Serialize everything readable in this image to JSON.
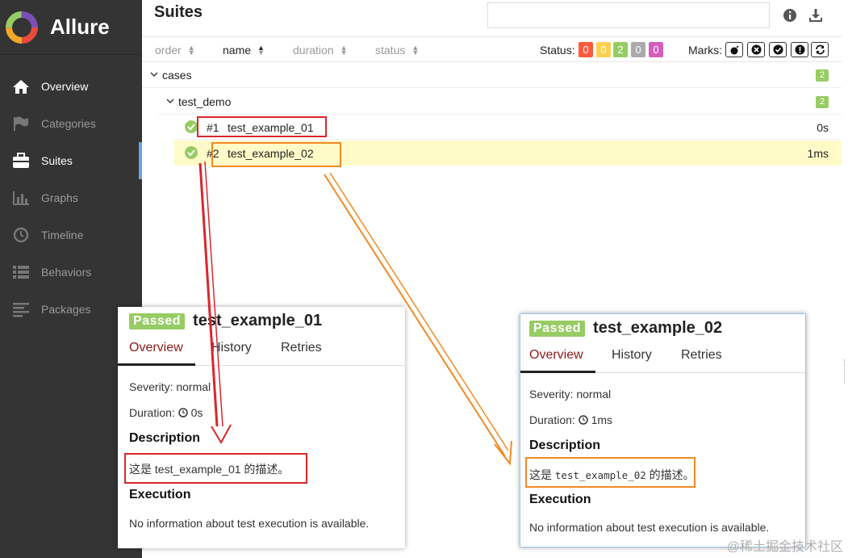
{
  "brand": {
    "name": "Allure"
  },
  "sidebar": {
    "items": [
      {
        "label": "Overview",
        "icon": "home-icon",
        "state": "highlight"
      },
      {
        "label": "Categories",
        "icon": "flag-icon",
        "state": "dim"
      },
      {
        "label": "Suites",
        "icon": "briefcase-icon",
        "state": "active"
      },
      {
        "label": "Graphs",
        "icon": "bar-chart-icon",
        "state": "dim"
      },
      {
        "label": "Timeline",
        "icon": "clock-icon",
        "state": "dim"
      },
      {
        "label": "Behaviors",
        "icon": "list-icon",
        "state": "dim"
      },
      {
        "label": "Packages",
        "icon": "align-left-icon",
        "state": "dim"
      }
    ]
  },
  "header": {
    "title": "Suites",
    "search_value": ""
  },
  "sortbar": {
    "columns": [
      "order",
      "name",
      "duration",
      "status"
    ],
    "status_label": "Status:",
    "status_counts": [
      {
        "value": "0",
        "color": "#fd5a3e"
      },
      {
        "value": "0",
        "color": "#ffd050"
      },
      {
        "value": "2",
        "color": "#97cc64"
      },
      {
        "value": "0",
        "color": "#aaaaaa"
      },
      {
        "value": "0",
        "color": "#d35ebe"
      }
    ],
    "marks_label": "Marks:"
  },
  "tree": {
    "suite": {
      "name": "cases",
      "count": "2"
    },
    "subsuite": {
      "name": "test_demo",
      "count": "2"
    },
    "cases": [
      {
        "num": "#1",
        "name": "test_example_01",
        "duration": "0s"
      },
      {
        "num": "#2",
        "name": "test_example_02",
        "duration": "1ms"
      }
    ]
  },
  "panels": [
    {
      "status": "Passed",
      "title": "test_example_01",
      "tabs": [
        "Overview",
        "History",
        "Retries"
      ],
      "severity": "Severity: normal",
      "duration_label": "Duration:",
      "duration": "0s",
      "description_heading": "Description",
      "description": "这是 test_example_01 的描述。",
      "execution_heading": "Execution",
      "execution_text": "No information about test execution is available."
    },
    {
      "status": "Passed",
      "title": "test_example_02",
      "tabs": [
        "Overview",
        "History",
        "Retries"
      ],
      "severity": "Severity: normal",
      "duration_label": "Duration:",
      "duration": "1ms",
      "description_prefix": "这是",
      "description_code": "test_example_02",
      "description_suffix": "的描述。",
      "description_heading": "Description",
      "execution_heading": "Execution",
      "execution_text": "No information about test execution is available."
    }
  ],
  "colors": {
    "red_annotation": "#d9262c",
    "orange_annotation": "#f08a24",
    "passed": "#97cc64"
  },
  "watermark": "@稀土掘金技术社区"
}
